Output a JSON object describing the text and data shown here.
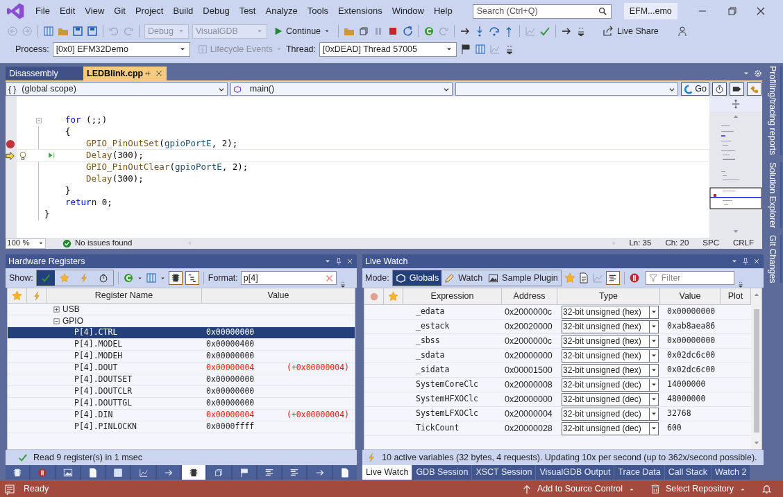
{
  "menu": [
    "File",
    "Edit",
    "View",
    "Git",
    "Project",
    "Build",
    "Debug",
    "Test",
    "Analyze",
    "Tools",
    "Extensions",
    "Window",
    "Help"
  ],
  "search": {
    "placeholder": "Search (Ctrl+Q)"
  },
  "window": {
    "title": "EFM...emo"
  },
  "toolbar": {
    "configuration": "Debug",
    "platform": "VisualGDB",
    "continue": "Continue",
    "live_share": "Live Share",
    "process_label": "Process:",
    "process": "[0x0] EFM32Demo",
    "lifecycle": "Lifecycle Events",
    "thread_label": "Thread:",
    "thread": "[0xDEAD] Thread 57005"
  },
  "editor": {
    "tabs": [
      {
        "label": "Disassembly",
        "selected": false
      },
      {
        "label": "LEDBlink.cpp",
        "selected": true
      }
    ],
    "scope_glyph": "{ }",
    "scope": "(global scope)",
    "function": "main()",
    "go": "Go",
    "lines": [
      {
        "breakpoint": false,
        "current": false,
        "fold": true,
        "tokens": [
          {
            "kind": "keyword",
            "text": "for"
          },
          {
            "kind": "plain",
            "text": " (;;)"
          }
        ]
      },
      {
        "breakpoint": false,
        "current": false,
        "fold": false,
        "tokens": [
          {
            "kind": "plain",
            "text": "{"
          }
        ],
        "children": [
          {
            "breakpoint": true,
            "current": false,
            "fold": false,
            "tokens": [
              {
                "kind": "function",
                "text": "GPIO_PinOutSet"
              },
              {
                "kind": "plain",
                "text": "("
              },
              {
                "kind": "identifier",
                "text": "gpioPortE"
              },
              {
                "kind": "plain",
                "text": ", 2);"
              }
            ]
          },
          {
            "breakpoint": false,
            "current": true,
            "fold": false,
            "tokens": [
              {
                "kind": "function",
                "text": "Delay"
              },
              {
                "kind": "plain",
                "text": "(300);"
              }
            ]
          },
          {
            "breakpoint": false,
            "current": false,
            "fold": false,
            "tokens": [
              {
                "kind": "function",
                "text": "GPIO_PinOutClear"
              },
              {
                "kind": "plain",
                "text": "("
              },
              {
                "kind": "identifier",
                "text": "gpioPortE"
              },
              {
                "kind": "plain",
                "text": ", 2);"
              }
            ]
          },
          {
            "breakpoint": false,
            "current": false,
            "fold": false,
            "tokens": [
              {
                "kind": "function",
                "text": "Delay"
              },
              {
                "kind": "plain",
                "text": "(300);"
              }
            ]
          }
        ]
      },
      {
        "breakpoint": false,
        "current": false,
        "fold": false,
        "tokens": [
          {
            "kind": "plain",
            "text": "}"
          }
        ]
      },
      {
        "breakpoint": false,
        "current": false,
        "fold": false,
        "tokens": [
          {
            "kind": "keyword",
            "text": "return"
          },
          {
            "kind": "plain",
            "text": " 0;"
          }
        ]
      }
    ],
    "closing_line": {
      "breakpoint": false,
      "current": false,
      "fold": false,
      "tokens": [
        {
          "kind": "plain",
          "text": "}"
        }
      ]
    },
    "zoom": "100 %",
    "issues": "No issues found",
    "ln": "Ln: 35",
    "ch": "Ch: 20",
    "spacing": "SPC",
    "eol": "CRLF"
  },
  "side_tabs": [
    "Profiling/tracing reports",
    "Solution Explorer",
    "Git Changes"
  ],
  "registers": {
    "title": "Hardware Registers",
    "show_label": "Show:",
    "format_label": "Format:",
    "format": "p[4]",
    "columns": [
      "Register Name",
      "Value"
    ],
    "groups": [
      {
        "name": "USB",
        "expanded": false
      },
      {
        "name": "GPIO",
        "expanded": true,
        "children": [
          {
            "name": "P[4].CTRL",
            "value": "0x00000000",
            "changed": false,
            "selected": true
          },
          {
            "name": "P[4].MODEL",
            "value": "0x00000400",
            "changed": false,
            "selected": false
          },
          {
            "name": "P[4].MODEH",
            "value": "0x00000000",
            "changed": false,
            "selected": false
          },
          {
            "name": "P[4].DOUT",
            "value": "0x00000004",
            "delta": "(+0x00000004)",
            "changed": true,
            "selected": false
          },
          {
            "name": "P[4].DOUTSET",
            "value": "0x00000000",
            "changed": false,
            "selected": false
          },
          {
            "name": "P[4].DOUTCLR",
            "value": "0x00000000",
            "changed": false,
            "selected": false
          },
          {
            "name": "P[4].DOUTTGL",
            "value": "0x00000000",
            "changed": false,
            "selected": false
          },
          {
            "name": "P[4].DIN",
            "value": "0x00000004",
            "delta": "(+0x00000004)",
            "changed": true,
            "selected": false
          },
          {
            "name": "P[4].PINLOCKN",
            "value": "0x0000ffff",
            "changed": false,
            "selected": false
          }
        ]
      }
    ],
    "status": "Read 9 register(s) in 1 msec",
    "tool_windows": [
      {
        "selected": false
      },
      {
        "selected": false
      },
      {
        "selected": false
      },
      {
        "selected": false
      },
      {
        "selected": false
      },
      {
        "selected": false
      },
      {
        "selected": false
      },
      {
        "selected": true
      },
      {
        "selected": false
      },
      {
        "selected": false
      },
      {
        "selected": false
      },
      {
        "selected": false
      },
      {
        "selected": false
      },
      {
        "selected": false
      }
    ]
  },
  "live_watch": {
    "title": "Live Watch",
    "mode_label": "Mode:",
    "modes": [
      {
        "label": "Globals",
        "selected": true
      },
      {
        "label": "Watch",
        "selected": false
      },
      {
        "label": "Sample Plugin",
        "selected": false
      }
    ],
    "filter": {
      "placeholder": "Filter"
    },
    "columns": [
      "Expression",
      "Address",
      "Type",
      "Value",
      "Plot"
    ],
    "rows": [
      {
        "expression": "_edata",
        "address": "0x2000000c",
        "type": "32-bit unsigned (hex)",
        "value": "0x00000000"
      },
      {
        "expression": "_estack",
        "address": "0x20020000",
        "type": "32-bit unsigned (hex)",
        "value": "0xab8aea86"
      },
      {
        "expression": "_sbss",
        "address": "0x2000000c",
        "type": "32-bit unsigned (hex)",
        "value": "0x00000000"
      },
      {
        "expression": "_sdata",
        "address": "0x20000000",
        "type": "32-bit unsigned (hex)",
        "value": "0x02dc6c00"
      },
      {
        "expression": "_sidata",
        "address": "0x00001500",
        "type": "32-bit unsigned (hex)",
        "value": "0x02dc6c00"
      },
      {
        "expression": "SystemCoreClc",
        "address": "0x20000008",
        "type": "32-bit unsigned (dec)",
        "value": "14000000"
      },
      {
        "expression": "SystemHFXOClc",
        "address": "0x20000000",
        "type": "32-bit unsigned (dec)",
        "value": "48000000"
      },
      {
        "expression": "SystemLFXOClc",
        "address": "0x20000004",
        "type": "32-bit unsigned (dec)",
        "value": "32768"
      },
      {
        "expression": "TickCount",
        "address": "0x20000028",
        "type": "32-bit unsigned (dec)",
        "value": "600"
      }
    ],
    "status": "10 active variables (32 bytes, 4 requests). Updating 10x per second (up to 362x/second possible).",
    "tabs": [
      {
        "label": "Live Watch",
        "selected": true
      },
      {
        "label": "GDB Session",
        "selected": false
      },
      {
        "label": "XSCT Session",
        "selected": false
      },
      {
        "label": "VisualGDB Output",
        "selected": false
      },
      {
        "label": "Trace Data",
        "selected": false
      },
      {
        "label": "Call Stack",
        "selected": false
      },
      {
        "label": "Watch 2",
        "selected": false
      }
    ]
  },
  "status_bar": {
    "ready": "Ready",
    "source_control": "Add to Source Control",
    "repository": "Select Repository"
  }
}
